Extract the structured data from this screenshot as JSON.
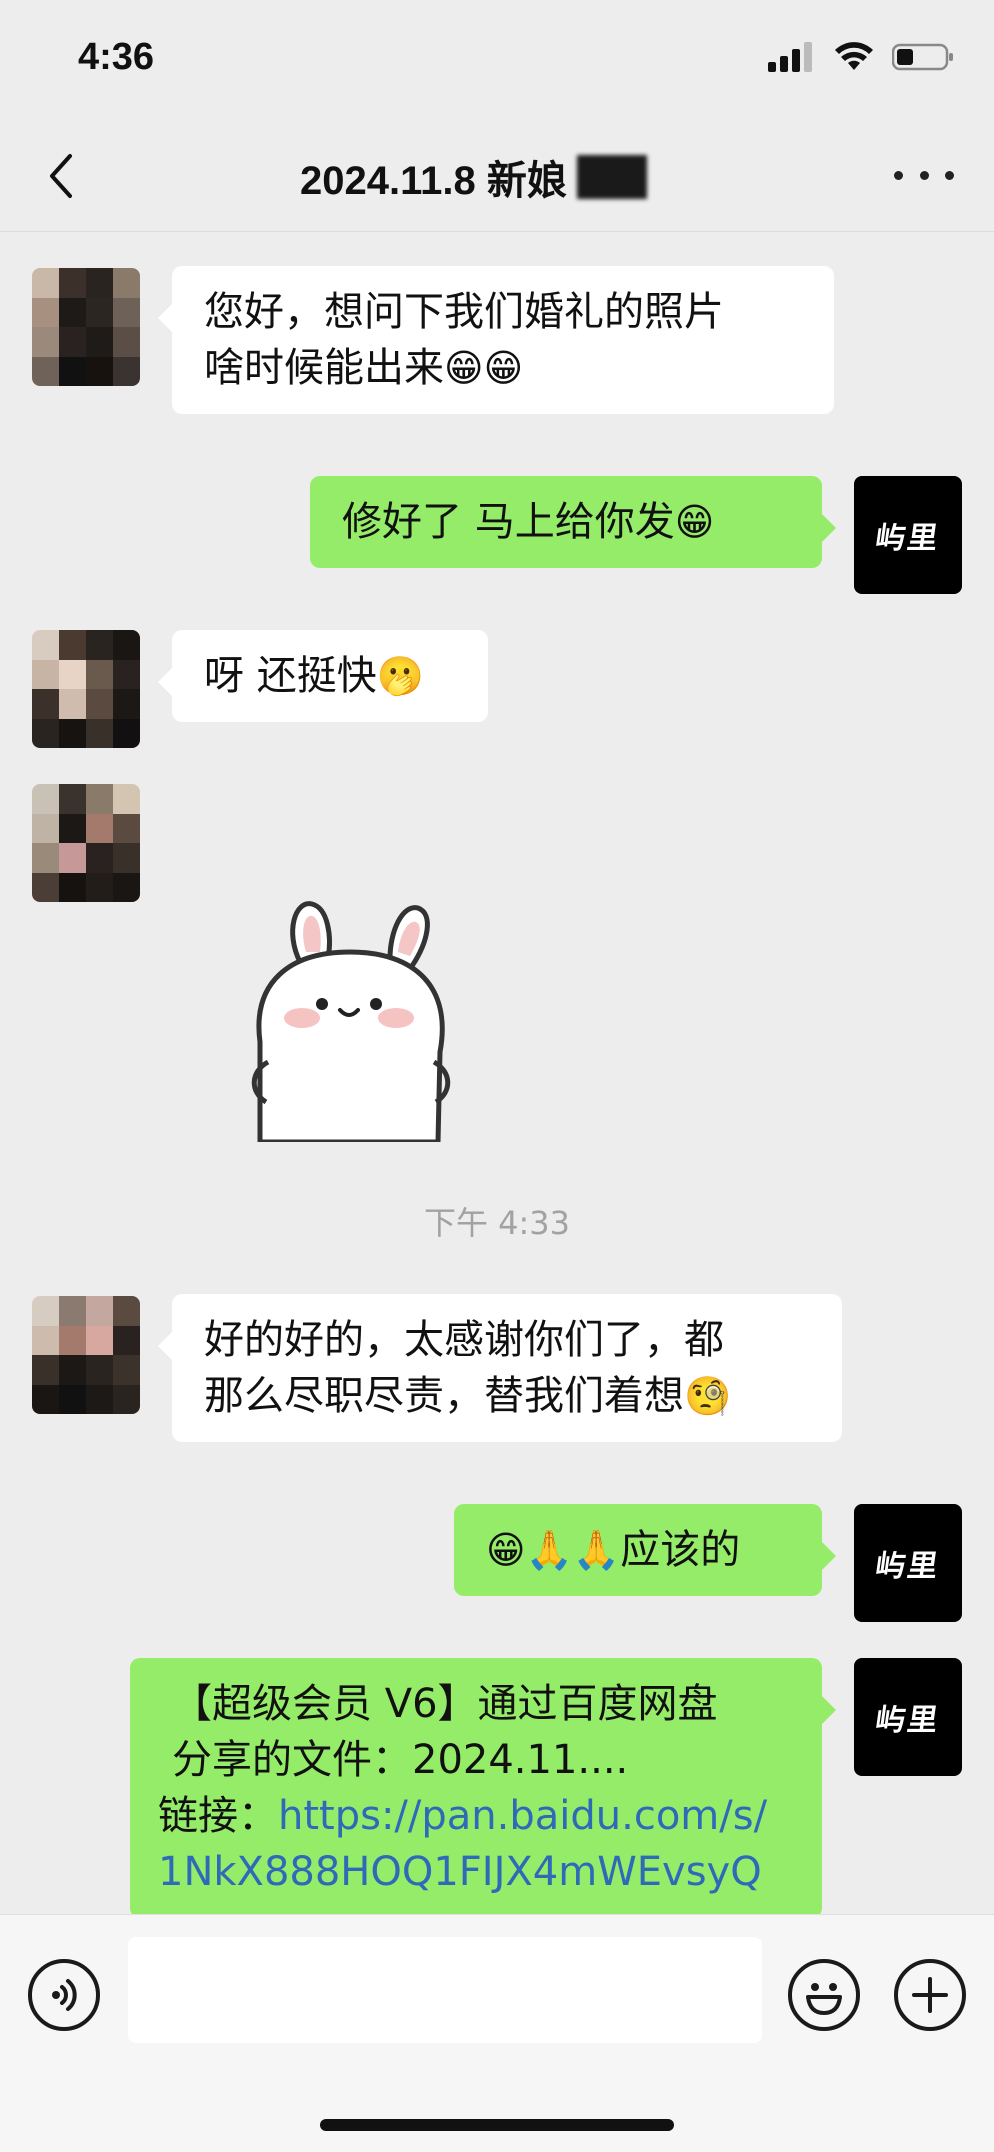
{
  "status_bar": {
    "time": "4:36"
  },
  "nav": {
    "title": "2024.11.8 新娘"
  },
  "messages": [
    {
      "side": "in",
      "text_line1": "您好，想问下我们婚礼的照片",
      "text_line2": "啥时候能出来",
      "emoji": "😁😁"
    },
    {
      "side": "out",
      "text": "修好了  马上给你发",
      "emoji": "😁"
    },
    {
      "side": "in",
      "text": "呀 还挺快",
      "emoji": "🫢"
    },
    {
      "side": "in",
      "type": "sticker",
      "sticker": "white-bunny-sticker"
    },
    {
      "type": "timestamp",
      "text": "下午 4:33"
    },
    {
      "side": "in",
      "text_line1": "好的好的，太感谢你们了，都",
      "text_line2": "那么尽职尽责，替我们着想",
      "emoji": "🧐"
    },
    {
      "side": "out",
      "emoji": "😁🙏🙏",
      "text": "应该的"
    },
    {
      "side": "out",
      "text_line1": "【超级会员 V6】通过百度网盘",
      "text_line2": "分享的文件：2024.11....",
      "link_label": "链接：",
      "link_line1": "https://pan.baidu.com/s/",
      "link_line2": "1NkX888HOQ1FIJX4mWEvsyQ"
    }
  ],
  "brand_avatar_text": "屿里",
  "colors": {
    "background": "#ededed",
    "incoming_bubble": "#ffffff",
    "outgoing_bubble": "#95ec69",
    "link": "#2e6ab8"
  },
  "input_bar": {
    "icons": [
      "voice-icon",
      "emoji-icon",
      "plus-icon"
    ]
  }
}
